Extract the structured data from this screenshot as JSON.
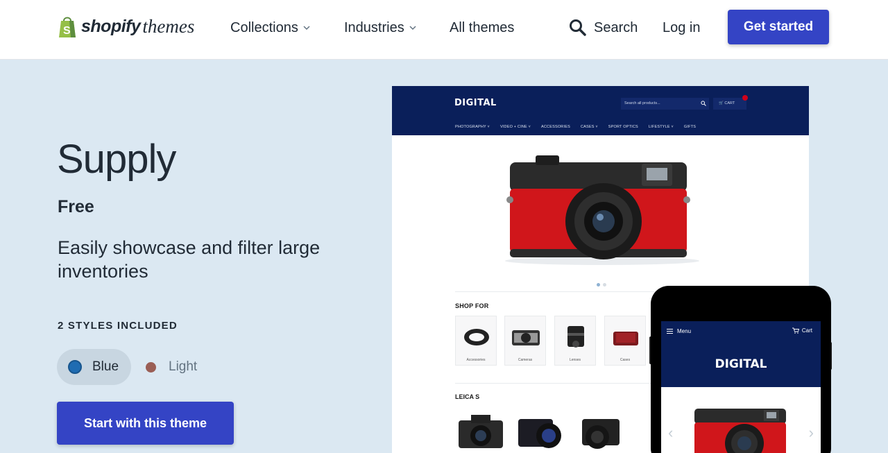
{
  "header": {
    "logo_brand": "shopify",
    "logo_suffix": "themes",
    "nav": {
      "collections": "Collections",
      "industries": "Industries",
      "all_themes": "All themes",
      "search": "Search",
      "login": "Log in"
    },
    "cta": "Get started"
  },
  "theme": {
    "name": "Supply",
    "price": "Free",
    "tagline": "Easily showcase and filter large inventories",
    "styles_label": "2 STYLES INCLUDED",
    "styles": [
      {
        "label": "Blue",
        "color": "#1f6cb2",
        "selected": true
      },
      {
        "label": "Light",
        "color": "#9a5e55",
        "selected": false
      }
    ],
    "start_button": "Start with this theme"
  },
  "preview": {
    "store_logo": "DIGITAL",
    "search_placeholder": "Search all products...",
    "cart_label": "CART",
    "menu": [
      "PHOTOGRAPHY ˅",
      "VIDEO + CINE ˅",
      "ACCESSORIES",
      "CASES ˅",
      "SPORT OPTICS",
      "LIFESTYLE ˅",
      "GIFTS"
    ],
    "shop_for_heading": "SHOP FOR",
    "categories": [
      "Accessories",
      "Cameras",
      "Lenses",
      "Cases"
    ],
    "collection_heading": "LEICA S"
  },
  "mobile_preview": {
    "menu_label": "Menu",
    "cart_label": "Cart",
    "store_logo": "DIGITAL"
  },
  "colors": {
    "accent": "#3444c5",
    "page_background": "#dbe8f2",
    "store_navy": "#0a1f5a"
  }
}
